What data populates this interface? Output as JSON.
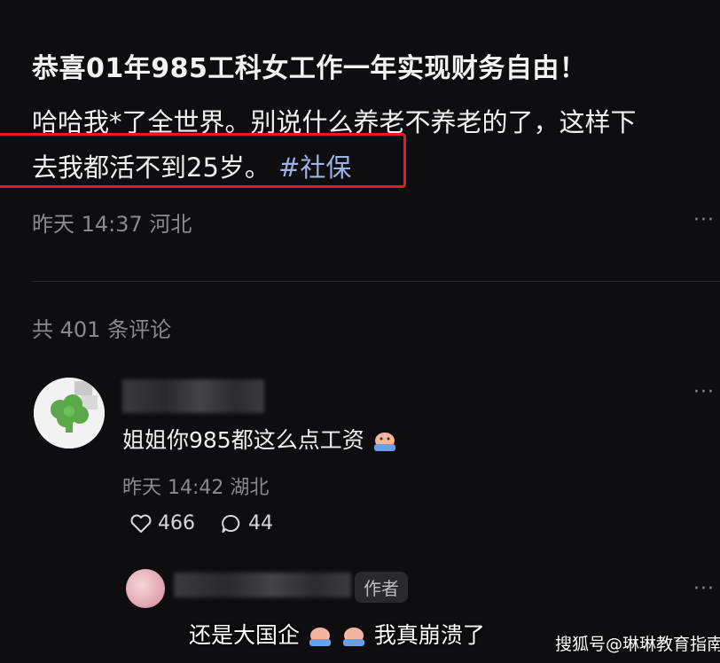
{
  "post": {
    "title": "恭喜01年985工科女工作一年实现财务自由！",
    "body_line1": "哈哈我*了全世界。别说什么养老不养老的了，这样下",
    "body_line2_text": "去我都活不到25岁。",
    "body_line2_tag": "#社保",
    "meta": "昨天 14:37 河北",
    "more": "···"
  },
  "comments_header": "共 401 条评论",
  "comment1": {
    "text": "姐姐你985都这么点工资",
    "meta": "昨天 14:42 湖北",
    "likes": "466",
    "replies": "44",
    "more": "···"
  },
  "reply1": {
    "author_tag": "作者",
    "more": "···"
  },
  "subtitle": {
    "part1": "还是大国企",
    "part2": "我真崩溃了"
  },
  "watermark": "搜狐号@琳琳教育指南",
  "colors": {
    "background": "#0e0e10",
    "highlight_box": "#e02020",
    "hashtag": "#9eb2e3",
    "muted_text": "#8a8a8e"
  }
}
